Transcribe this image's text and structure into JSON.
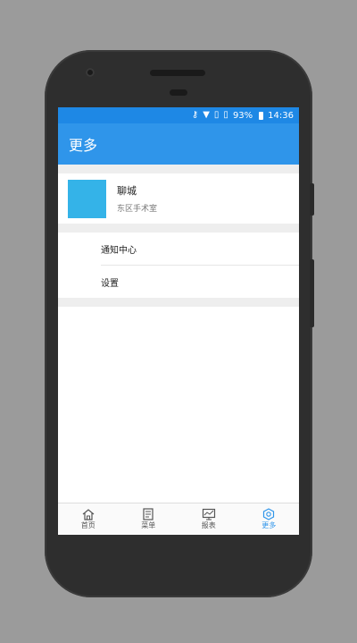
{
  "status": {
    "battery": "93%",
    "time": "14:36",
    "icons": [
      "key-icon",
      "wifi-icon",
      "no-sim-icon",
      "no-sim-icon",
      "battery-icon"
    ]
  },
  "toolbar": {
    "title": "更多"
  },
  "profile": {
    "name": "聊城",
    "subtitle": "东区手术室",
    "avatar_color": "#34b3e8"
  },
  "menu": [
    {
      "label": "通知中心"
    },
    {
      "label": "设置"
    }
  ],
  "bottom_nav": [
    {
      "label": "首页",
      "icon": "home-icon",
      "active": false
    },
    {
      "label": "菜单",
      "icon": "menu-list-icon",
      "active": false
    },
    {
      "label": "报表",
      "icon": "chart-icon",
      "active": false
    },
    {
      "label": "更多",
      "icon": "gear-icon",
      "active": true
    }
  ],
  "colors": {
    "primary": "#2f95ea",
    "status_bar": "#1e88e5",
    "background_gap": "#eeeeee"
  }
}
